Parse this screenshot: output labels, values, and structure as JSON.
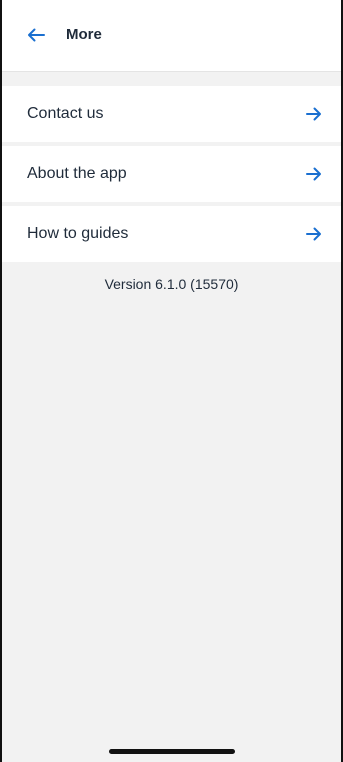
{
  "header": {
    "title": "More",
    "back_icon": "arrow-left-icon"
  },
  "menu": {
    "items": [
      {
        "label": "Contact us",
        "icon": "arrow-right-icon"
      },
      {
        "label": "About the app",
        "icon": "arrow-right-icon"
      },
      {
        "label": "How to guides",
        "icon": "arrow-right-icon"
      }
    ]
  },
  "footer": {
    "version": "Version 6.1.0 (15570)"
  },
  "colors": {
    "accent": "#1a6fd0",
    "text": "#1f2b3a",
    "background": "#f2f2f2"
  }
}
